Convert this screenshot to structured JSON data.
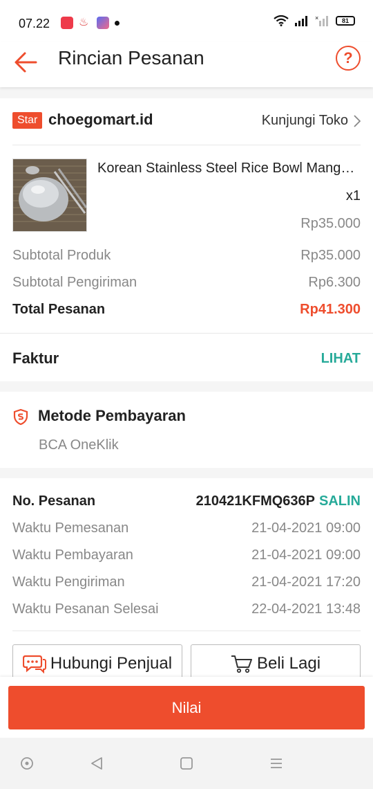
{
  "status_bar": {
    "time": "07.22",
    "battery": "81"
  },
  "header": {
    "title": "Rincian Pesanan",
    "back_icon": "arrow-left-icon",
    "help_label": "?"
  },
  "shop": {
    "badge": "Star",
    "name": "choegomart.id",
    "visit_label": "Kunjungi Toko"
  },
  "product": {
    "name": "Korean Stainless Steel Rice Bowl Mang…",
    "qty": "x1",
    "price": "Rp35.000"
  },
  "summary": {
    "subtotal_product_label": "Subtotal Produk",
    "subtotal_product_value": "Rp35.000",
    "subtotal_shipping_label": "Subtotal Pengiriman",
    "subtotal_shipping_value": "Rp6.300",
    "total_label": "Total Pesanan",
    "total_value": "Rp41.300"
  },
  "invoice": {
    "label": "Faktur",
    "link": "LIHAT"
  },
  "payment": {
    "title": "Metode Pembayaran",
    "method": "BCA OneKlik"
  },
  "order": {
    "number_label": "No. Pesanan",
    "number_value": "210421KFMQ636P",
    "copy_label": "SALIN",
    "rows": [
      {
        "label": "Waktu Pemesanan",
        "value": "21-04-2021 09:00"
      },
      {
        "label": "Waktu Pembayaran",
        "value": "21-04-2021 09:00"
      },
      {
        "label": "Waktu Pengiriman",
        "value": "21-04-2021 17:20"
      },
      {
        "label": "Waktu Pesanan Selesai",
        "value": "22-04-2021 13:48"
      }
    ]
  },
  "actions": {
    "chat_label": "Hubungi Penjual",
    "buy_again_label": "Beli Lagi",
    "rate_label": "Nilai"
  },
  "colors": {
    "accent": "#ee4d2d",
    "teal": "#26aa99"
  }
}
